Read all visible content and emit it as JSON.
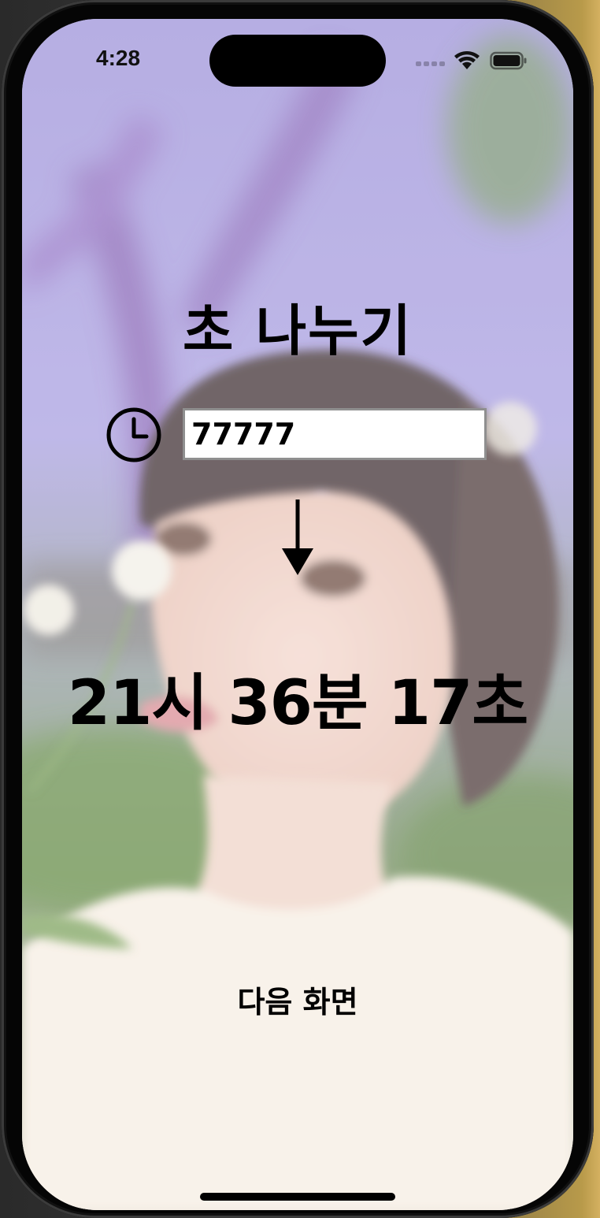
{
  "status_bar": {
    "time": "4:28"
  },
  "screen": {
    "title": "초 나누기",
    "input_value": "77777",
    "result": "21시 36분 17초",
    "next_button_label": "다음 화면"
  },
  "icons": {
    "clock": "clock-icon",
    "arrow": "arrow-down-icon",
    "wifi": "wifi-icon",
    "battery": "battery-icon"
  },
  "colors": {
    "text": "#000000",
    "input_border": "#8f8f8f",
    "background_tint": "#b7b0e6"
  }
}
